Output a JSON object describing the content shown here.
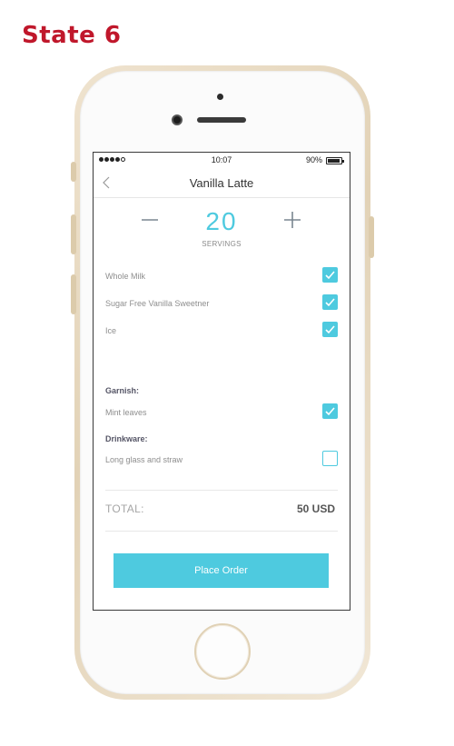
{
  "page": {
    "title": "State 6"
  },
  "status_bar": {
    "time": "10:07",
    "battery": "90%",
    "battery_level": 0.9
  },
  "nav": {
    "title": "Vanilla Latte"
  },
  "stepper": {
    "count": "20",
    "label": "SERVINGS"
  },
  "options": [
    {
      "label": "Whole Milk",
      "checked": true
    },
    {
      "label": "Sugar Free Vanilla Sweetner",
      "checked": true
    },
    {
      "label": "Ice",
      "checked": true
    }
  ],
  "garnish": {
    "heading": "Garnish:",
    "items": [
      {
        "label": "Mint leaves",
        "checked": true
      }
    ]
  },
  "drinkware": {
    "heading": "Drinkware:",
    "items": [
      {
        "label": "Long glass and straw",
        "checked": false
      }
    ]
  },
  "total": {
    "label": "TOTAL:",
    "value": "50 USD"
  },
  "order_button": {
    "label": "Place Order"
  },
  "colors": {
    "accent": "#4ecadf",
    "title_red": "#c0172b",
    "phone_gold": "#e2d2b6"
  },
  "icons": [
    "back-chevron-icon",
    "minus-icon",
    "plus-icon",
    "checkmark-icon",
    "home-button-icon"
  ]
}
